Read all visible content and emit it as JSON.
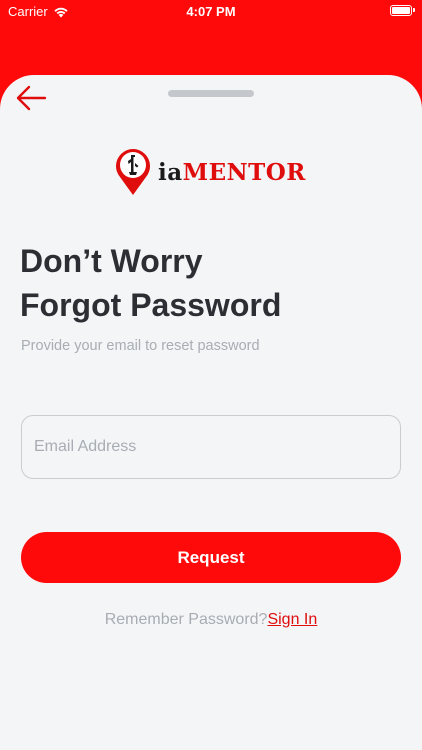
{
  "status_bar": {
    "carrier": "Carrier",
    "time": "4:07 PM",
    "icons": [
      "wifi-icon",
      "battery-icon"
    ]
  },
  "nav": {
    "back_icon": "arrow-left-icon"
  },
  "logo": {
    "prefix": "ia",
    "brand": "MENTOR",
    "icon": "map-pin-icon"
  },
  "heading": {
    "line1": "Don’t Worry",
    "line2": "Forgot Password"
  },
  "subtitle": "Provide your email to reset password",
  "email_field": {
    "placeholder": "Email Address",
    "value": ""
  },
  "request_button": {
    "label": "Request"
  },
  "footer": {
    "prompt": "Remember Password?",
    "link": "Sign In"
  },
  "colors": {
    "accent": "#ff0a0a",
    "background": "#f4f5f7",
    "heading_text": "#2d2e33",
    "muted_text": "#a8adb3"
  }
}
